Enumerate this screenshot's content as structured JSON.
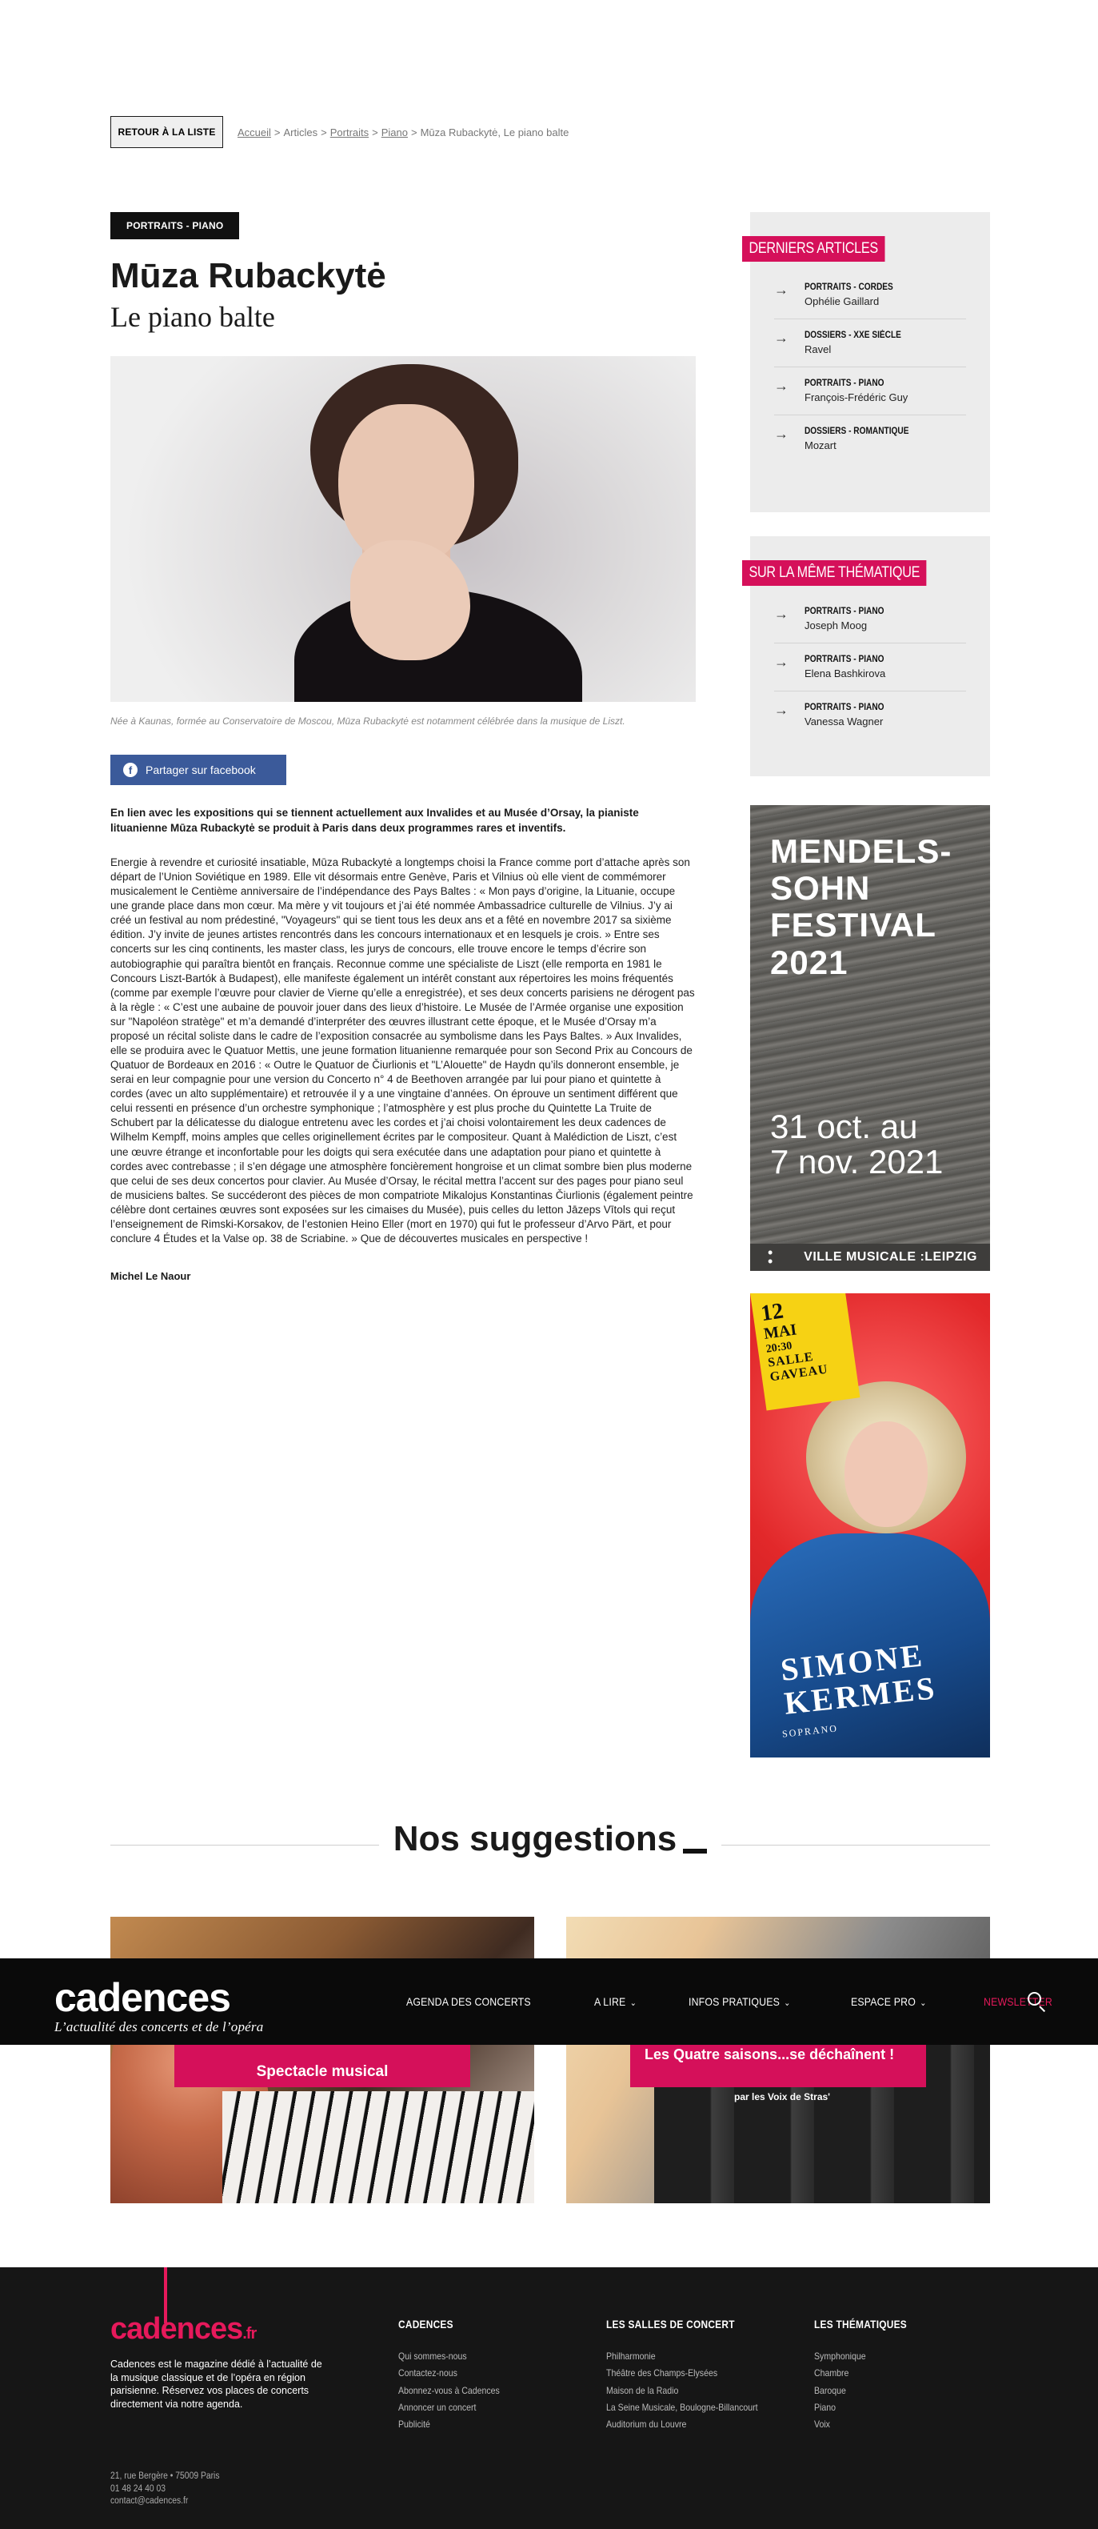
{
  "topbar": {
    "back_label": "RETOUR À LA LISTE",
    "breadcrumb": [
      "Accueil",
      "Articles",
      "Portraits",
      "Piano",
      "Mūza Rubackytė, Le piano balte"
    ],
    "sep": ">"
  },
  "article": {
    "category": "PORTRAITS - PIANO",
    "title": "Mūza Rubackytė",
    "subtitle": "Le piano balte",
    "caption": "Née à Kaunas, formée au Conservatoire de Moscou, Mūza Rubackytė est notamment célébrée dans la musique de Liszt.",
    "share_label": "Partager sur facebook",
    "lead": "En lien avec les expositions qui se tiennent actuellement aux Invalides et au Musée d’Orsay, la pianiste lituanienne Mūza Rubackytė se produit à Paris dans deux programmes rares et inventifs.",
    "body": "Energie à revendre et curiosité insatiable, Mūza Rubackytė a longtemps choisi la France comme port d’attache après son départ de l’Union Soviétique en 1989. Elle vit désormais entre Genève, Paris et Vilnius où elle vient de commémorer musicalement le Centième anniversaire de l’indépendance des Pays Baltes : « Mon pays d’origine, la Lituanie, occupe une grande place dans mon cœur. Ma mère y vit toujours et j’ai été nommée Ambassadrice culturelle de Vilnius. J’y ai créé un festival au nom prédestiné, \"Voyageurs\" qui se tient tous les deux ans et a fêté en novembre 2017 sa sixième édition. J’y invite de jeunes artistes rencontrés dans les concours internationaux et en lesquels je crois. » Entre ses concerts sur les cinq continents, les master class, les jurys de concours, elle trouve encore le temps d’écrire son autobiographie qui paraîtra bientôt en français. Reconnue comme une spécialiste de Liszt (elle remporta en 1981 le Concours Liszt-Bartók à Budapest), elle manifeste également un intérêt constant aux répertoires les moins fréquentés (comme par exemple l’œuvre pour clavier de Vierne qu’elle a enregistrée), et ses deux concerts parisiens ne dérogent pas à la règle : « C’est une aubaine de pouvoir jouer dans des lieux d’histoire. Le Musée de l’Armée organise une exposition sur \"Napoléon stratège\" et m’a demandé d’interpréter des œuvres illustrant cette époque, et le Musée d’Orsay m’a proposé un récital soliste dans le cadre de l’exposition consacrée au symbolisme dans les Pays Baltes. » Aux Invalides, elle se produira avec le Quatuor Mettis, une jeune formation lituanienne remarquée pour son Second Prix au Concours de Quatuor de Bordeaux en 2016 : « Outre le Quatuor de Čiurlionis et \"L’Alouette\" de Haydn qu’ils donneront ensemble, je serai en leur compagnie pour une version du Concerto n° 4 de Beethoven arrangée par lui pour piano et quintette à cordes (avec un alto supplémentaire) et retrouvée il y a une vingtaine d’années. On éprouve un sentiment différent que celui ressenti en présence d’un orchestre symphonique ; l’atmosphère y est plus proche du Quintette La Truite de Schubert par la délicatesse du dialogue entretenu avec les cordes et j’ai choisi volontairement les deux cadences de Wilhelm Kempff, moins amples que celles originellement écrites par le compositeur. Quant à Malédiction de Liszt, c’est une œuvre étrange et inconfortable pour les doigts qui sera exécutée dans une adaptation pour piano et quintette à cordes avec contrebasse ; il s’en dégage une atmosphère foncièrement hongroise et un climat sombre bien plus moderne que celui de ses deux concertos pour clavier. Au Musée d’Orsay, le récital mettra l’accent sur des pages pour piano seul de musiciens baltes. Se succéderont des pièces de mon compatriote Mikalojus Konstantinas Čiurlionis (également peintre célèbre dont certaines œuvres sont exposées sur les cimaises du Musée), puis celles du letton Jāzeps Vītols qui reçut l’enseignement de Rimski-Korsakov, de l’estonien Heino Eller (mort en 1970) qui fut le professeur d’Arvo Pärt, et pour conclure 4 Études et la Valse op. 38 de Scriabine. » Que de découvertes musicales en perspective !",
    "author": "Michel Le Naour"
  },
  "sidebar": {
    "latest": {
      "heading": "DERNIERS ARTICLES",
      "items": [
        {
          "cat": "PORTRAITS - CORDES",
          "name": "Ophélie Gaillard"
        },
        {
          "cat": "DOSSIERS - XXE SIÈCLE",
          "name": "Ravel"
        },
        {
          "cat": "PORTRAITS - PIANO",
          "name": "François-Frédéric Guy"
        },
        {
          "cat": "DOSSIERS - ROMANTIQUE",
          "name": "Mozart"
        }
      ]
    },
    "same_theme": {
      "heading": "SUR LA MÊME THÉMATIQUE",
      "items": [
        {
          "cat": "PORTRAITS - PIANO",
          "name": "Joseph Moog"
        },
        {
          "cat": "PORTRAITS - PIANO",
          "name": "Elena Bashkirova"
        },
        {
          "cat": "PORTRAITS - PIANO",
          "name": "Vanessa Wagner"
        }
      ]
    },
    "arrow_icon": "→"
  },
  "ads": {
    "mendelssohn": {
      "title": "MENDELS-\nSOHN\nFESTIVAL\n2021",
      "dates": "31 oct. au\n7 nov. 2021",
      "footer": "VILLE MUSICALE :LEIPZIG"
    },
    "kermes": {
      "day": "12",
      "month": "MAI",
      "time": "20:30",
      "venue": "SALLE GAVEAU",
      "name": "SIMONE\nKERMES",
      "role": "SOPRANO"
    }
  },
  "suggestions": {
    "heading": "Nos suggestions",
    "cards": [
      {
        "label": "Spectacle musical"
      },
      {
        "label": "Les Quatre saisons...se déchaînent !",
        "sub": "par les Voix de Stras'"
      }
    ]
  },
  "nav": {
    "logo": "cadences",
    "tagline": "L’actualité des concerts et de l’opéra",
    "items": [
      "AGENDA DES CONCERTS",
      "A LIRE",
      "INFOS PRATIQUES",
      "ESPACE PRO",
      "NEWSLETTER"
    ],
    "accent": "#e6195b"
  },
  "footer": {
    "logo": "cadences",
    "logo_suffix": ".fr",
    "desc": "Cadences est le magazine dédié à l’actualité de la musique classique et de l’opéra en région parisienne. Réservez vos places de concerts directement via notre agenda.",
    "address": [
      "21, rue Bergère • 75009 Paris",
      "01 48 24 40 03",
      "contact@cadences.fr"
    ],
    "col1": {
      "title": "CADENCES",
      "links": [
        "Qui sommes-nous",
        "Contactez-nous",
        "Abonnez-vous à Cadences",
        "Annoncer un concert",
        "Publicité"
      ]
    },
    "col2": {
      "title": "LES SALLES DE CONCERT",
      "links": [
        "Philharmonie",
        "Théâtre des Champs-Elysées",
        "Maison de la Radio",
        "La Seine Musicale, Boulogne-Billancourt",
        "Auditorium du Louvre"
      ]
    },
    "col3": {
      "title": "LES THÉMATIQUES",
      "links": [
        "Symphonique",
        "Chambre",
        "Baroque",
        "Piano",
        "Voix"
      ]
    }
  }
}
